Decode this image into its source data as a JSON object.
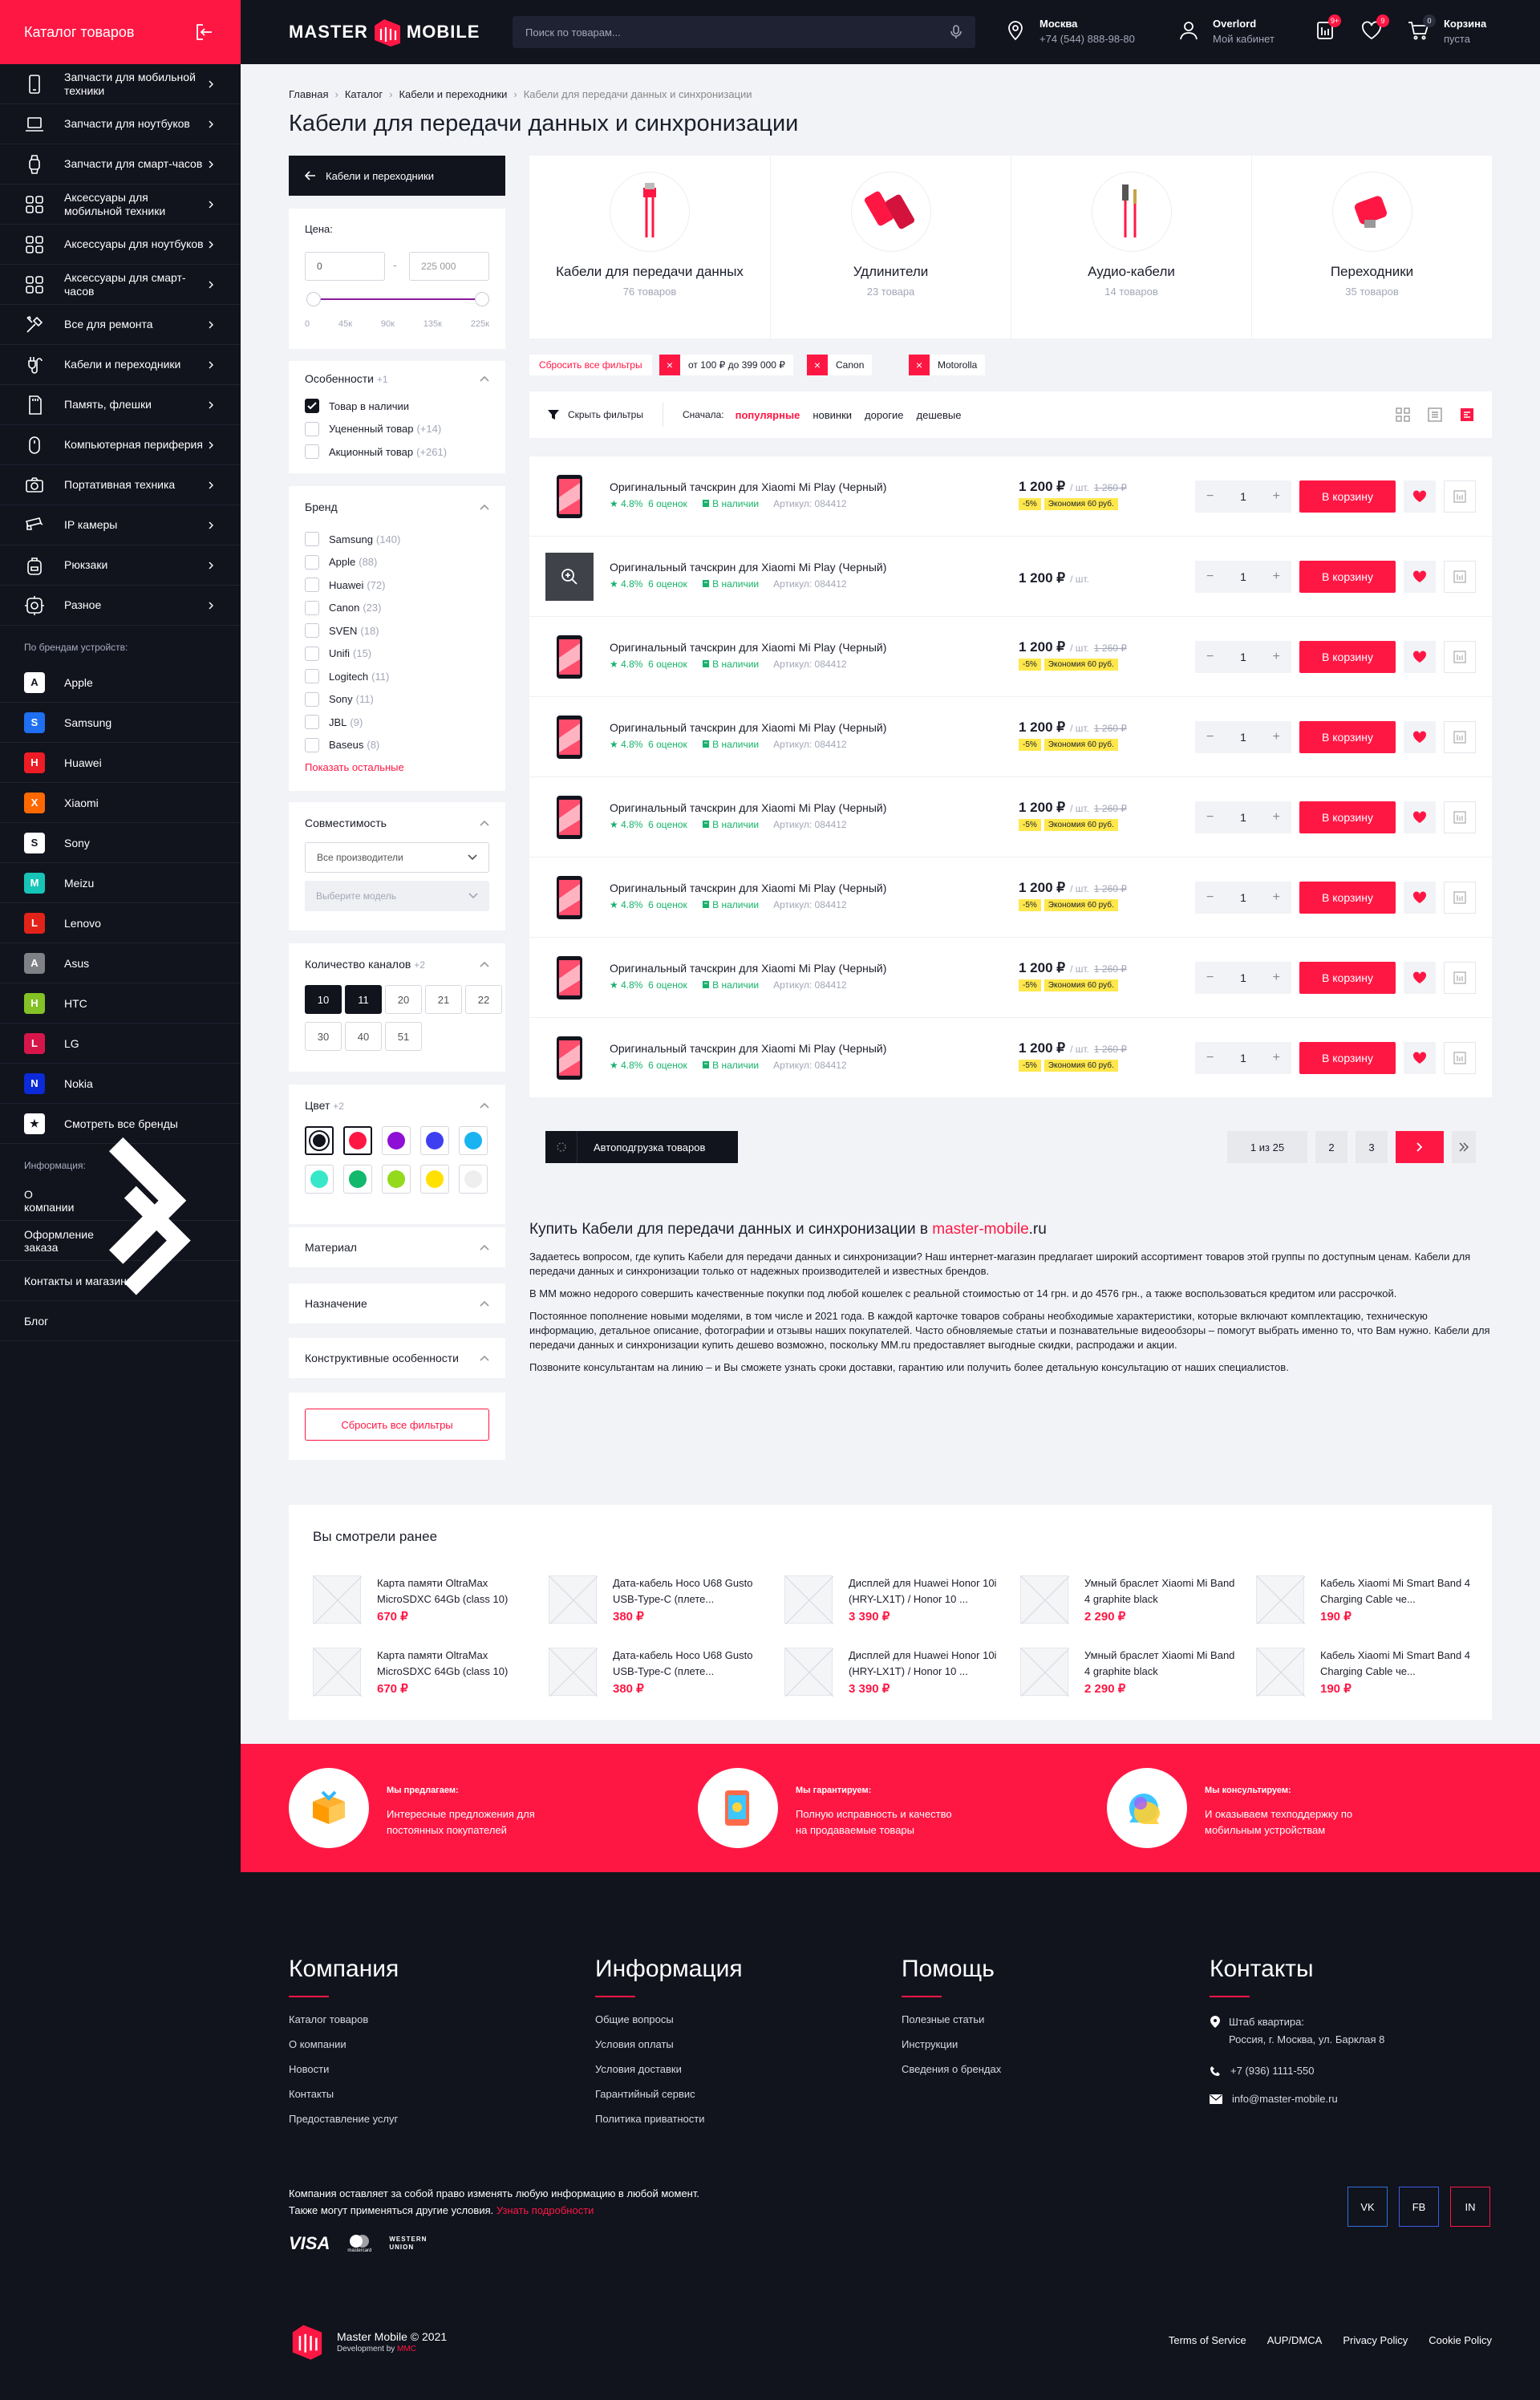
{
  "sidebar": {
    "title": "Каталог товаров",
    "categories": [
      {
        "label": "Запчасти для мобильной техники",
        "icon": "smartphone-icon"
      },
      {
        "label": "Запчасти для ноутбуков",
        "icon": "laptop-icon"
      },
      {
        "label": "Запчасти для смарт-часов",
        "icon": "watch-icon"
      },
      {
        "label": "Аксессуары для мобильной техники",
        "icon": "grid-icon"
      },
      {
        "label": "Аксессуары для ноутбуков",
        "icon": "grid-icon"
      },
      {
        "label": "Аксессуары для смарт-часов",
        "icon": "grid-icon"
      },
      {
        "label": "Все для ремонта",
        "icon": "tools-icon"
      },
      {
        "label": "Кабели и переходники",
        "icon": "cable-icon"
      },
      {
        "label": "Память, флешки",
        "icon": "sd-card-icon"
      },
      {
        "label": "Компьютерная периферия",
        "icon": "mouse-icon"
      },
      {
        "label": "Портативная техника",
        "icon": "camera-icon"
      },
      {
        "label": "IP камеры",
        "icon": "cctv-icon"
      },
      {
        "label": "Рюкзаки",
        "icon": "backpack-icon"
      },
      {
        "label": "Разное",
        "icon": "misc-icon"
      }
    ],
    "brands_caption": "По брендам устройств:",
    "brands": [
      {
        "letter": "A",
        "label": "Apple",
        "color": "#ffffff",
        "text": "#11131d"
      },
      {
        "letter": "S",
        "label": "Samsung",
        "color": "#1e6ff1",
        "text": "#ffffff"
      },
      {
        "letter": "H",
        "label": "Huawei",
        "color": "#ee1c25",
        "text": "#ffffff"
      },
      {
        "letter": "X",
        "label": "Xiaomi",
        "color": "#ff6900",
        "text": "#ffffff"
      },
      {
        "letter": "S",
        "label": "Sony",
        "color": "#ffffff",
        "text": "#11131d"
      },
      {
        "letter": "M",
        "label": "Meizu",
        "color": "#16c5b7",
        "text": "#ffffff"
      },
      {
        "letter": "L",
        "label": "Lenovo",
        "color": "#e2231a",
        "text": "#ffffff"
      },
      {
        "letter": "A",
        "label": "Asus",
        "color": "#7f8187",
        "text": "#ffffff"
      },
      {
        "letter": "H",
        "label": "HTC",
        "color": "#84c225",
        "text": "#ffffff"
      },
      {
        "letter": "L",
        "label": "LG",
        "color": "#d6164b",
        "text": "#ffffff"
      },
      {
        "letter": "N",
        "label": "Nokia",
        "color": "#0b2ad8",
        "text": "#ffffff"
      },
      {
        "letter": "★",
        "label": "Смотреть все бренды",
        "color": "#ffffff",
        "text": "#11131d"
      }
    ],
    "info_caption": "Информация:",
    "info": [
      {
        "label": "О компании",
        "arrow": true
      },
      {
        "label": "Оформление заказа",
        "arrow": true
      },
      {
        "label": "Контакты и магазины",
        "arrow": false
      },
      {
        "label": "Блог",
        "arrow": false
      }
    ]
  },
  "header": {
    "logo_left": "MASTER",
    "logo_right": "MOBILE",
    "search_placeholder": "Поиск по товарам...",
    "city": "Москва",
    "phone": "+74 (544) 888-98-80",
    "user": "Overlord",
    "user_sub": "Мой кабинет",
    "compare_badge": "9+",
    "fav_badge": "9",
    "cart_badge": "0",
    "cart_label": "Корзина",
    "cart_sub": "пуста"
  },
  "breadcrumbs": [
    "Главная",
    "Каталог",
    "Кабели и переходники",
    "Кабели для передачи данных и синхронизации"
  ],
  "page_title": "Кабели для передачи данных и синхронизации",
  "filters": {
    "back": "Кабели и переходники",
    "price_label": "Цена:",
    "price_min": "0",
    "price_max": "225 000",
    "price_ticks": [
      "0",
      "45к",
      "90к",
      "135к",
      "225к"
    ],
    "features_label": "Особенности",
    "features_count": "+1",
    "features": [
      {
        "label": "Товар в наличии",
        "count": "",
        "on": true
      },
      {
        "label": "Уцененный товар",
        "count": "(+14)",
        "on": false
      },
      {
        "label": "Акционный товар",
        "count": "(+261)",
        "on": false
      }
    ],
    "brand_label": "Бренд",
    "brands": [
      {
        "label": "Samsung",
        "count": "(140)"
      },
      {
        "label": "Apple",
        "count": "(88)"
      },
      {
        "label": "Huawei",
        "count": "(72)"
      },
      {
        "label": "Canon",
        "count": "(23)"
      },
      {
        "label": "SVEN",
        "count": "(18)"
      },
      {
        "label": "Unifi",
        "count": "(15)"
      },
      {
        "label": "Logitech",
        "count": "(11)"
      },
      {
        "label": "Sony",
        "count": "(11)"
      },
      {
        "label": "JBL",
        "count": "(9)"
      },
      {
        "label": "Baseus",
        "count": "(8)"
      }
    ],
    "show_more": "Показать остальные",
    "compat_label": "Совместимость",
    "compat_maker": "Все производители",
    "compat_model": "Выберите модель",
    "channels_label": "Количество каналов",
    "channels_count": "+2",
    "channels": [
      {
        "v": "10",
        "on": true
      },
      {
        "v": "11",
        "on": true
      },
      {
        "v": "20",
        "on": false
      },
      {
        "v": "21",
        "on": false
      },
      {
        "v": "22",
        "on": false
      },
      {
        "v": "30",
        "on": false
      },
      {
        "v": "40",
        "on": false
      },
      {
        "v": "51",
        "on": false
      }
    ],
    "color_label": "Цвет",
    "color_count": "+2",
    "colors": [
      {
        "c": "#11131d",
        "on": true
      },
      {
        "c": "#ff1744",
        "on": true
      },
      {
        "c": "#8e0fd6",
        "on": false
      },
      {
        "c": "#3f3ff2",
        "on": false
      },
      {
        "c": "#1ab3f2",
        "on": false
      },
      {
        "c": "#36e8c9",
        "on": false
      },
      {
        "c": "#12b86c",
        "on": false
      },
      {
        "c": "#93d91c",
        "on": false
      },
      {
        "c": "#ffe000",
        "on": false
      },
      {
        "c": "#eeeeee",
        "on": false
      }
    ],
    "material": "Материал",
    "purpose": "Назначение",
    "construction": "Конструктивные особенности",
    "reset": "Сбросить все фильтры"
  },
  "categories": [
    {
      "name": "Кабели для передачи данных",
      "count": "76 товаров"
    },
    {
      "name": "Удлинители",
      "count": "23 товара"
    },
    {
      "name": "Аудио-кабели",
      "count": "14 товаров"
    },
    {
      "name": "Переходники",
      "count": "35 товаров"
    }
  ],
  "active_filters": {
    "reset": "Сбросить все фильтры",
    "tags": [
      "от 100 ₽ до 399 000 ₽",
      "Canon",
      "Motorolla"
    ]
  },
  "sort": {
    "hide": "Скрыть фильтры",
    "label": "Сначала:",
    "options": [
      {
        "l": "популярные",
        "on": true
      },
      {
        "l": "новинки",
        "on": false
      },
      {
        "l": "дорогие",
        "on": false
      },
      {
        "l": "дешевые",
        "on": false
      }
    ]
  },
  "products": [
    {
      "name": "Оригинальный тачскрин для Xiaomi Mi Play (Черный)",
      "rating": "4.8%",
      "reviews": "6 оценок",
      "stock": "В наличии",
      "sku": "Артикул: 084412",
      "price": "1 200 ₽",
      "unit": "/ шт.",
      "old": "1 260 ₽",
      "disc": "-5%",
      "save": "Экономия 60 руб.",
      "qty": "1",
      "buy": "В корзину",
      "hover": false
    },
    {
      "name": "Оригинальный тачскрин для Xiaomi Mi Play (Черный)",
      "rating": "4.8%",
      "reviews": "6 оценок",
      "stock": "В наличии",
      "sku": "Артикул: 084412",
      "price": "1 200 ₽",
      "unit": "/ шт.",
      "old": "",
      "disc": "",
      "save": "",
      "qty": "1",
      "buy": "В корзину",
      "hover": true
    },
    {
      "name": "Оригинальный тачскрин для Xiaomi Mi Play (Черный)",
      "rating": "4.8%",
      "reviews": "6 оценок",
      "stock": "В наличии",
      "sku": "Артикул: 084412",
      "price": "1 200 ₽",
      "unit": "/ шт.",
      "old": "1 260 ₽",
      "disc": "-5%",
      "save": "Экономия 60 руб.",
      "qty": "1",
      "buy": "В корзину",
      "hover": false
    },
    {
      "name": "Оригинальный тачскрин для Xiaomi Mi Play (Черный)",
      "rating": "4.8%",
      "reviews": "6 оценок",
      "stock": "В наличии",
      "sku": "Артикул: 084412",
      "price": "1 200 ₽",
      "unit": "/ шт.",
      "old": "1 260 ₽",
      "disc": "-5%",
      "save": "Экономия 60 руб.",
      "qty": "1",
      "buy": "В корзину",
      "hover": false
    },
    {
      "name": "Оригинальный тачскрин для Xiaomi Mi Play (Черный)",
      "rating": "4.8%",
      "reviews": "6 оценок",
      "stock": "В наличии",
      "sku": "Артикул: 084412",
      "price": "1 200 ₽",
      "unit": "/ шт.",
      "old": "1 260 ₽",
      "disc": "-5%",
      "save": "Экономия 60 руб.",
      "qty": "1",
      "buy": "В корзину",
      "hover": false
    },
    {
      "name": "Оригинальный тачскрин для Xiaomi Mi Play (Черный)",
      "rating": "4.8%",
      "reviews": "6 оценок",
      "stock": "В наличии",
      "sku": "Артикул: 084412",
      "price": "1 200 ₽",
      "unit": "/ шт.",
      "old": "1 260 ₽",
      "disc": "-5%",
      "save": "Экономия 60 руб.",
      "qty": "1",
      "buy": "В корзину",
      "hover": false
    },
    {
      "name": "Оригинальный тачскрин для Xiaomi Mi Play (Черный)",
      "rating": "4.8%",
      "reviews": "6 оценок",
      "stock": "В наличии",
      "sku": "Артикул: 084412",
      "price": "1 200 ₽",
      "unit": "/ шт.",
      "old": "1 260 ₽",
      "disc": "-5%",
      "save": "Экономия 60 руб.",
      "qty": "1",
      "buy": "В корзину",
      "hover": false
    },
    {
      "name": "Оригинальный тачскрин для Xiaomi Mi Play (Черный)",
      "rating": "4.8%",
      "reviews": "6 оценок",
      "stock": "В наличии",
      "sku": "Артикул: 084412",
      "price": "1 200 ₽",
      "unit": "/ шт.",
      "old": "1 260 ₽",
      "disc": "-5%",
      "save": "Экономия 60 руб.",
      "qty": "1",
      "buy": "В корзину",
      "hover": false
    }
  ],
  "pagination": {
    "autoload": "Автоподгрузка товаров",
    "status": "1 из 25",
    "pages": [
      "2",
      "3"
    ]
  },
  "seo": {
    "title_pre": "Купить Кабели для передачи данных и синхронизации в ",
    "title_site": "master-mobile",
    ".ru": ".ru",
    "p1": "Задаетесь вопросом, где купить Кабели для передачи данных и синхронизации? Наш интернет-магазин предлагает широкий ассортимент товаров этой группы по доступным ценам. Кабели для передачи данных и синхронизации только от надежных производителей и известных брендов.",
    "p2": "В ММ можно недорого совершить качественные покупки под любой кошелек с реальной стоимостью от 14 грн. и до 4576 грн., а также воспользоваться кредитом или рассрочкой.",
    "p3": "Постоянное пополнение новыми моделями, в том числе и 2021 года. В каждой карточке товаров собраны необходимые характеристики, которые включают комплектацию, техническую информацию, детальное описание, фотографии и отзывы наших покупателей. Часто обновляемые статьи и познавательные видеообзоры – помогут выбрать именно то, что Вам нужно. Кабели для передачи данных и синхронизации купить дешево возможно, поскольку MM.ru предоставляет выгодные скидки, распродажи и акции.",
    "p4": "Позвоните консультантам на линию – и Вы сможете узнать сроки доставки, гарантию или получить более детальную консультацию от наших специалистов."
  },
  "recent": {
    "title": "Вы смотрели ранее",
    "items": [
      {
        "name": "Карта памяти OltraMax MicroSDXC 64Gb (class 10)",
        "price": "670 ₽"
      },
      {
        "name": "Дата-кабель Hoco U68 Gusto USB-Type-C (плете...",
        "price": "380 ₽"
      },
      {
        "name": "Дисплей для Huawei Honor 10i (HRY-LX1T) / Honor 10 ...",
        "price": "3 390 ₽"
      },
      {
        "name": "Умный браслет Xiaomi Mi Band 4 graphite black",
        "price": "2 290 ₽"
      },
      {
        "name": "Кабель Xiaomi Mi Smart Band 4 Charging Cable че...",
        "price": "190 ₽"
      },
      {
        "name": "Карта памяти OltraMax MicroSDXC 64Gb (class 10)",
        "price": "670 ₽"
      },
      {
        "name": "Дата-кабель Hoco U68 Gusto USB-Type-C (плете...",
        "price": "380 ₽"
      },
      {
        "name": "Дисплей для Huawei Honor 10i (HRY-LX1T) / Honor 10 ...",
        "price": "3 390 ₽"
      },
      {
        "name": "Умный браслет Xiaomi Mi Band 4 graphite black",
        "price": "2 290 ₽"
      },
      {
        "name": "Кабель Xiaomi Mi Smart Band 4 Charging Cable че...",
        "price": "190 ₽"
      }
    ]
  },
  "advantages": [
    {
      "head": "Мы предлагаем:",
      "text1": "Интересные предложения для",
      "text2": "постоянных покупателей"
    },
    {
      "head": "Мы гарантируем:",
      "text1": "Полную исправность и качество",
      "text2": "на продаваемые товары"
    },
    {
      "head": "Мы консультируем:",
      "text1": "И оказываем техподдержку по",
      "text2": "мобильным устройствам"
    }
  ],
  "footer": {
    "cols": [
      {
        "title": "Компания",
        "links": [
          "Каталог товаров",
          "О компании",
          "Новости",
          "Контакты",
          "Предоставление услуг"
        ]
      },
      {
        "title": "Информация",
        "links": [
          "Общие вопросы",
          "Условия оплаты",
          "Условия доставки",
          "Гарантийный сервис",
          "Политика приватности"
        ]
      },
      {
        "title": "Помощь",
        "links": [
          "Полезные статьи",
          "Инструкции",
          "Сведения о брендах"
        ]
      }
    ],
    "contacts_title": "Контакты",
    "hq_label": "Штаб квартира:",
    "hq_addr": "Россия, г. Москва, ул. Барклая 8",
    "phone": "+7 (936) 1111-550",
    "email": "info@master-mobile.ru",
    "disclaimer1": "Компания оставляет за собой право изменять любую информацию в любой момент.",
    "disclaimer2": "Также могут применяться другие условия. ",
    "disclaimer_link": "Узнать подробности",
    "payments": [
      "VISA",
      "mastercard",
      "WESTERN UNION"
    ],
    "social": [
      {
        "l": "VK",
        "c": "#2f72d9"
      },
      {
        "l": "FB",
        "c": "#3b5ce6"
      },
      {
        "l": "IN",
        "c": "#ff1744"
      }
    ],
    "copyright": "Master Mobile © 2021",
    "dev_pre": "Development by ",
    "dev": "MMC",
    "links": [
      "Terms of Service",
      "AUP/DMCA",
      "Privacy Policy",
      "Cookie Policy"
    ]
  }
}
